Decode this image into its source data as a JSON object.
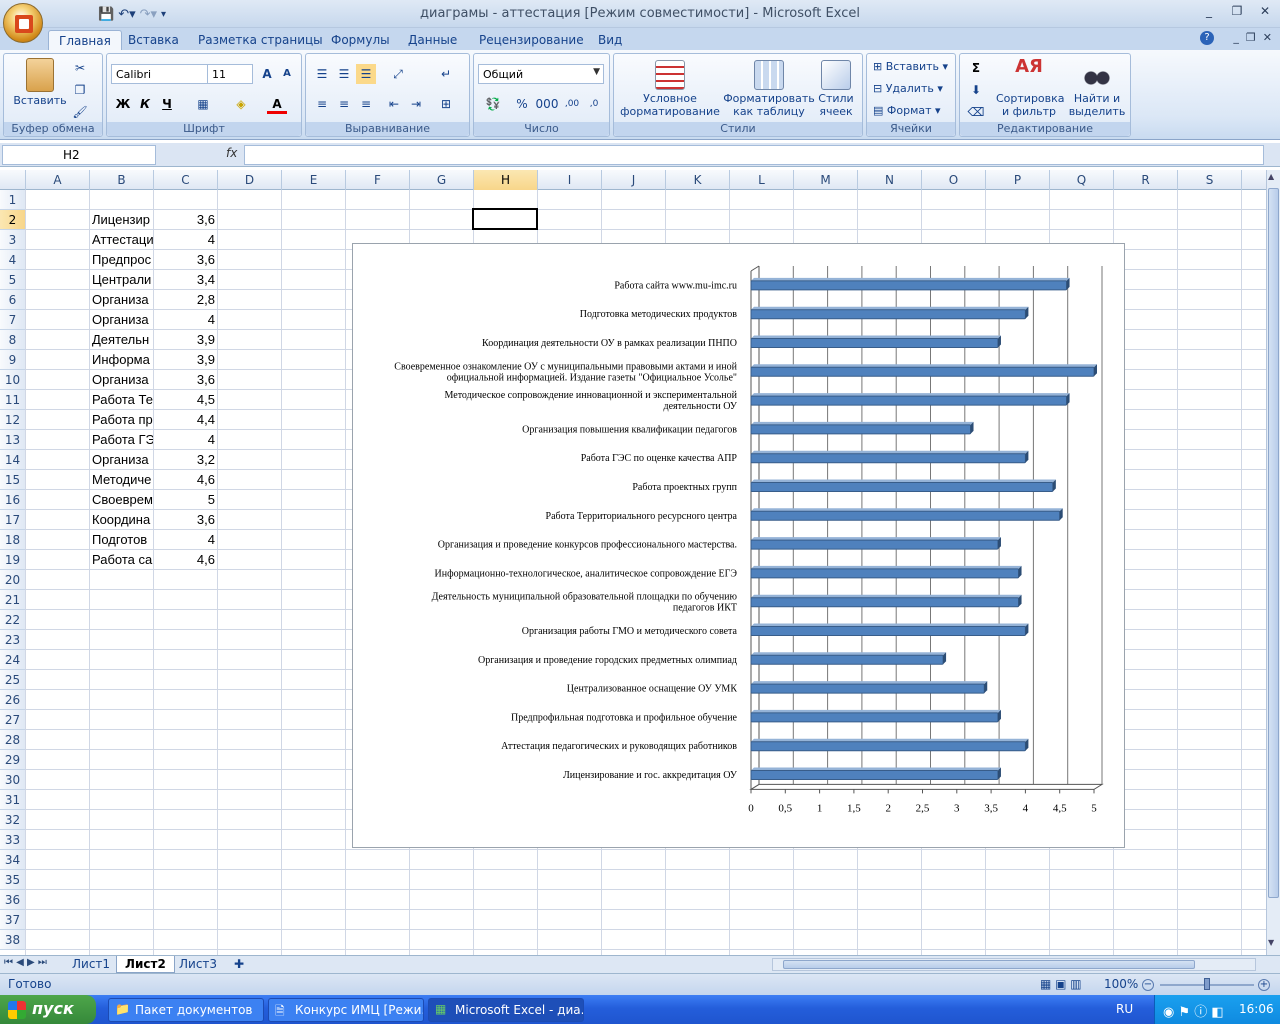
{
  "window": {
    "title": "диаграмы - аттестация  [Режим совместимости] - Microsoft Excel",
    "minimize": "_",
    "restore": "❐",
    "close": "✕"
  },
  "ribbon_tabs": [
    "Главная",
    "Вставка",
    "Разметка страницы",
    "Формулы",
    "Данные",
    "Рецензирование",
    "Вид"
  ],
  "groups": {
    "clipboard": {
      "label": "Буфер обмена",
      "paste": "Вставить"
    },
    "font": {
      "label": "Шрифт",
      "font_name": "Calibri",
      "font_size": "11",
      "bold": "Ж",
      "italic": "К",
      "underline": "Ч"
    },
    "alignment": {
      "label": "Выравнивание"
    },
    "number": {
      "label": "Число",
      "format": "Общий",
      "percent": "%",
      "thousands": "000"
    },
    "styles": {
      "label": "Стили",
      "conditional": "Условное форматирование",
      "as_table": "Форматировать как таблицу",
      "cell_styles": "Стили ячеек"
    },
    "cells": {
      "label": "Ячейки",
      "insert": "Вставить",
      "delete": "Удалить",
      "format": "Формат"
    },
    "editing": {
      "label": "Редактирование",
      "sort": "Сортировка и фильтр",
      "find": "Найти и выделить"
    }
  },
  "formula_bar": {
    "name_box": "H2",
    "fx": "fx",
    "value": ""
  },
  "columns": [
    "A",
    "B",
    "C",
    "D",
    "E",
    "F",
    "G",
    "H",
    "I",
    "J",
    "K",
    "L",
    "M",
    "N",
    "O",
    "P",
    "Q",
    "R",
    "S"
  ],
  "rows": [
    "1",
    "2",
    "3",
    "4",
    "5",
    "6",
    "7",
    "8",
    "9",
    "10",
    "11",
    "12",
    "13",
    "14",
    "15",
    "16",
    "17",
    "18",
    "19",
    "20",
    "21",
    "22",
    "23",
    "24",
    "25",
    "26",
    "27",
    "28",
    "29",
    "30",
    "31",
    "32",
    "33",
    "34",
    "35",
    "36",
    "37",
    "38"
  ],
  "sheet_rows": [
    {
      "b": "Лицензир",
      "c": "3,6"
    },
    {
      "b": "Аттестаци",
      "c": "4"
    },
    {
      "b": "Предпрос",
      "c": "3,6"
    },
    {
      "b": "Централи",
      "c": "3,4"
    },
    {
      "b": "Организа",
      "c": "2,8"
    },
    {
      "b": "Организа",
      "c": "4"
    },
    {
      "b": "Деятельн",
      "c": "3,9"
    },
    {
      "b": "Информа",
      "c": "3,9"
    },
    {
      "b": "Организа",
      "c": "3,6"
    },
    {
      "b": "Работа Те",
      "c": "4,5"
    },
    {
      "b": "Работа пр",
      "c": "4,4"
    },
    {
      "b": "Работа ГЭ",
      "c": "4"
    },
    {
      "b": "Организа",
      "c": "3,2"
    },
    {
      "b": "Методиче",
      "c": "4,6"
    },
    {
      "b": "Своеврем",
      "c": "5"
    },
    {
      "b": "Координа",
      "c": "3,6"
    },
    {
      "b": "Подготов",
      "c": "4"
    },
    {
      "b": "Работа са",
      "c": "4,6"
    }
  ],
  "chart_data": {
    "type": "bar",
    "orientation": "horizontal",
    "categories": [
      "Работа сайта www.mu-imc.ru",
      "Подготовка методических продуктов",
      "Координация деятельности ОУ в рамках реализации ПНПО",
      "Своевременное ознакомление ОУ с муниципальными правовыми актами и иной официальной информацией. Издание газеты \"Официальное Усолье\"",
      "Методическое сопровождение инновационной и экспериментальной деятельности ОУ",
      "Организация повышения квалификации педагогов",
      "Работа ГЭС по оценке качества АПР",
      "Работа проектных групп",
      "Работа Территориального ресурсного центра",
      "Организация и проведение конкурсов профессионального мастерства.",
      "Информационно-технологическое, аналитическое сопровождение ЕГЭ",
      "Деятельность муниципальной образовательной площадки по обучению педагогов ИКТ",
      "Организация работы ГМО и методического совета",
      "Организация и проведение городских предметных олимпиад",
      "Централизованное оснащение ОУ УМК",
      "Предпрофильная подготовка и профильное обучение",
      "Аттестация педагогических  и руководящих работников",
      "Лицензирование и гос. аккредитация  ОУ"
    ],
    "category_lines": [
      [
        "Работа сайта www.mu-imc.ru"
      ],
      [
        "Подготовка методических продуктов"
      ],
      [
        "Координация деятельности ОУ в рамках реализации ПНПО"
      ],
      [
        "Своевременное ознакомление ОУ с муниципальными правовыми актами и иной",
        "официальной информацией. Издание газеты \"Официальное Усолье\""
      ],
      [
        "Методическое сопровождение инновационной и экспериментальной",
        "деятельности ОУ"
      ],
      [
        "Организация повышения квалификации педагогов"
      ],
      [
        "Работа ГЭС по оценке качества АПР"
      ],
      [
        "Работа проектных групп"
      ],
      [
        "Работа Территориального ресурсного центра"
      ],
      [
        "Организация и проведение конкурсов профессионального мастерства."
      ],
      [
        "Информационно-технологическое, аналитическое сопровождение ЕГЭ"
      ],
      [
        "Деятельность муниципальной образовательной площадки по обучению",
        "педагогов ИКТ"
      ],
      [
        "Организация работы ГМО и методического совета"
      ],
      [
        "Организация и проведение городских предметных олимпиад"
      ],
      [
        "Централизованное оснащение ОУ УМК"
      ],
      [
        "Предпрофильная подготовка и профильное обучение"
      ],
      [
        "Аттестация педагогических  и руководящих работников"
      ],
      [
        "Лицензирование и гос. аккредитация  ОУ"
      ]
    ],
    "values": [
      4.6,
      4,
      3.6,
      5,
      4.6,
      3.2,
      4,
      4.4,
      4.5,
      3.6,
      3.9,
      3.9,
      4,
      2.8,
      3.4,
      3.6,
      4,
      3.6
    ],
    "xticks": [
      "0",
      "0,5",
      "1",
      "1,5",
      "2",
      "2,5",
      "3",
      "3,5",
      "4",
      "4,5",
      "5"
    ],
    "xlim": [
      0,
      5
    ],
    "grid": true,
    "bar_color": "#4f81bd"
  },
  "sheet_tabs": [
    "Лист1",
    "Лист2",
    "Лист3"
  ],
  "status": {
    "ready": "Готово",
    "zoom": "100%"
  },
  "taskbar": {
    "start": "пуск",
    "tasks": [
      "Пакет документов",
      "Конкурс ИМЦ [Режи...",
      "Microsoft Excel - диа..."
    ],
    "lang": "RU",
    "clock": "16:06"
  }
}
